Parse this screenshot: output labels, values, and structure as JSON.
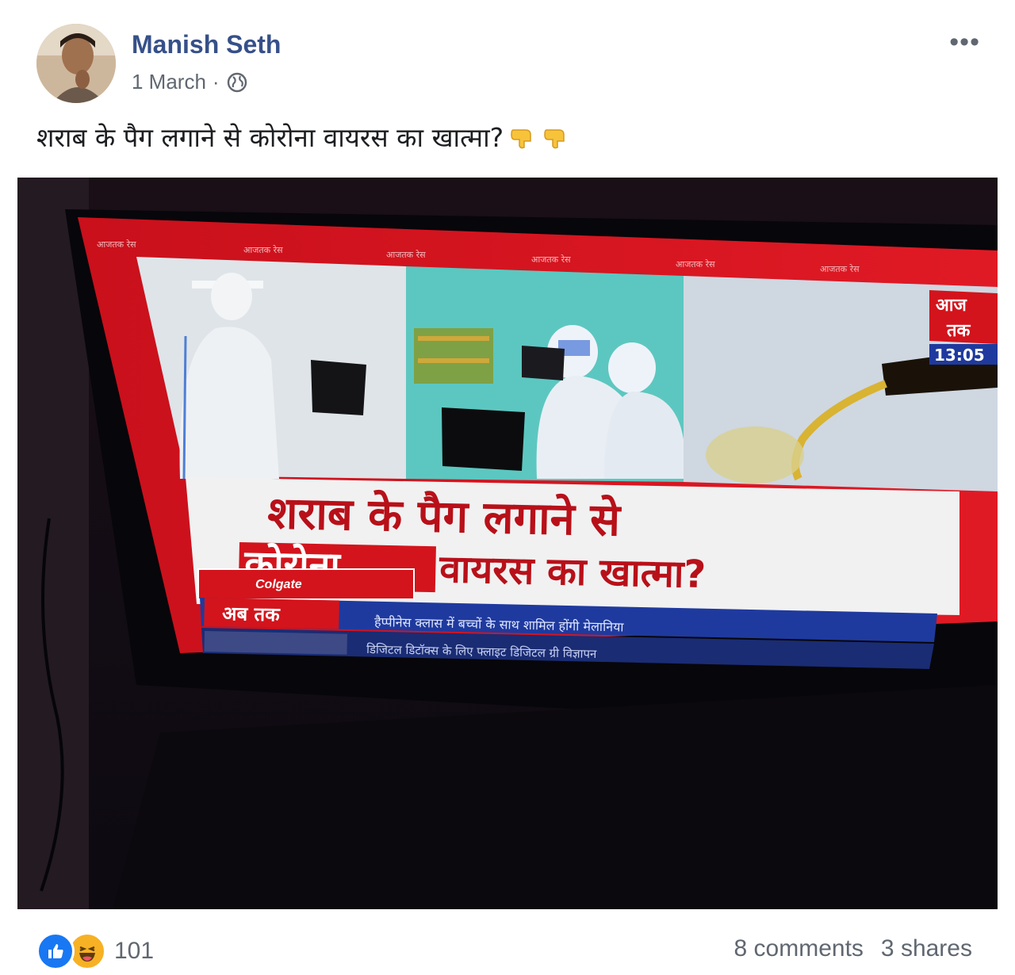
{
  "post": {
    "author": "Manish Seth",
    "date": "1 March",
    "separator": "·",
    "privacy_icon": "globe-icon",
    "more_label": "•••",
    "caption": "शराब के पैग लगाने से कोरोना वायरस का खात्मा?",
    "caption_emoji": "backhand-index-pointing-down"
  },
  "tv": {
    "channel_logo_top": "आज",
    "channel_logo_bottom": "तक",
    "clock": "13:05",
    "top_band_label": "आजतक रेस",
    "headline_line1": "शराब के पैग लगाने से",
    "headline_line2_a": "कोरोना",
    "headline_line2_b": "वायरस का खात्मा?",
    "sponsor": "Colgate",
    "ticker_tag": "अब तक",
    "ticker_text": "हैप्पीनेस क्लास में बच्चों के साथ शामिल होंगी मेलानिया",
    "ticker_text2": "डिजिटल डिटॉक्स के लिए फ्लाइट डिजिटल ग्री विज्ञापन"
  },
  "footer": {
    "reactions": [
      "like",
      "haha"
    ],
    "reaction_count": "101",
    "comments": "8 comments",
    "shares": "3 shares"
  },
  "colors": {
    "name_blue": "#365089",
    "meta_gray": "#606770",
    "tv_red": "#d3141c",
    "ticker_blue": "#1f3a9e"
  }
}
